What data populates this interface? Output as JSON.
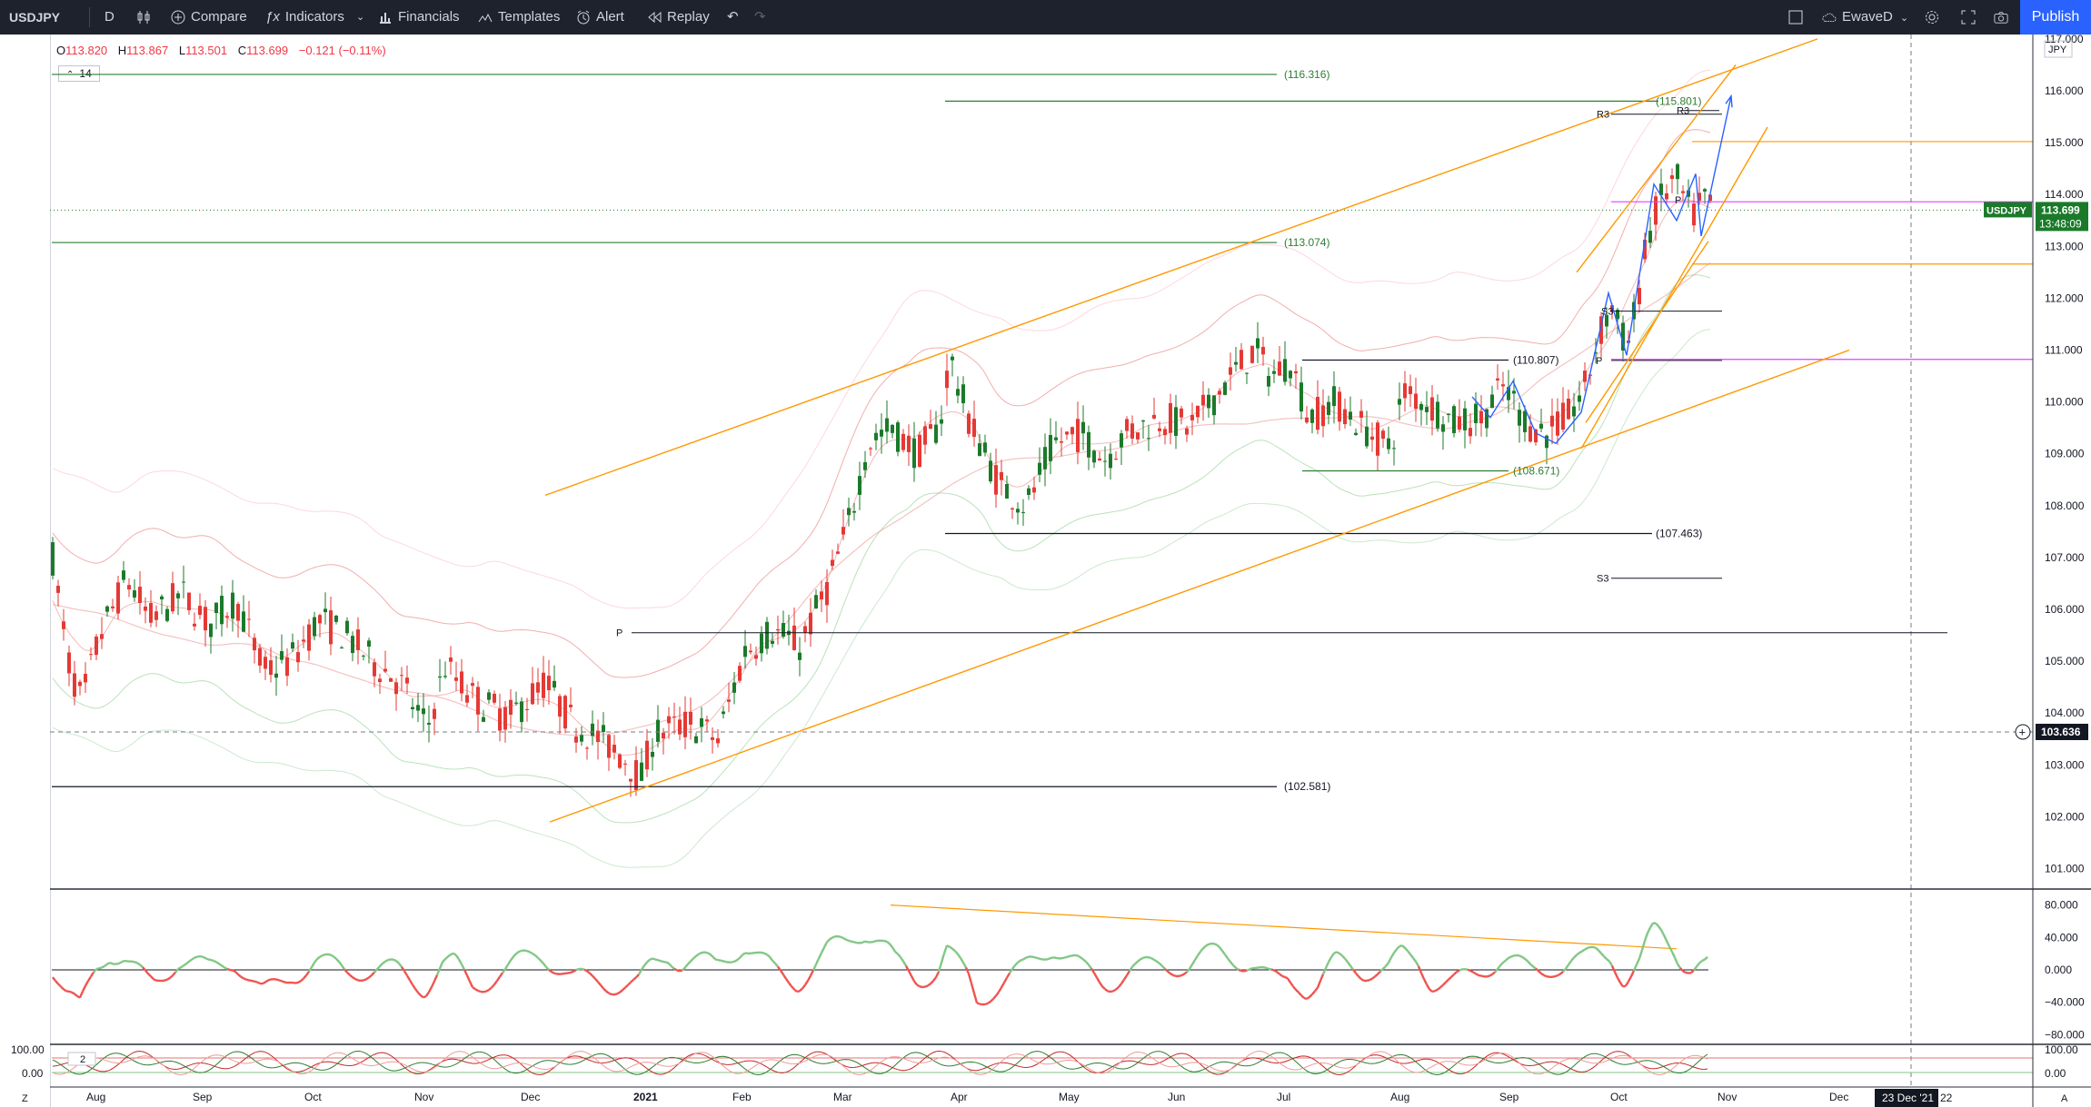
{
  "toolbar": {
    "symbol": "USDJPY",
    "interval": "D",
    "compare_label": "Compare",
    "indicators_label": "Indicators",
    "financials_label": "Financials",
    "templates_label": "Templates",
    "alert_label": "Alert",
    "replay_label": "Replay",
    "layout_name": "EwaveD",
    "publish_label": "Publish"
  },
  "legend": {
    "o_label": "O",
    "o": "113.820",
    "h_label": "H",
    "h": "113.867",
    "l_label": "L",
    "l": "113.501",
    "c_label": "C",
    "c": "113.699",
    "change": "−0.121 (−0.11%)",
    "rsi_period": "14",
    "stoch_period": "2"
  },
  "price_scale": {
    "currency": "JPY",
    "ticks": [
      "117.000",
      "116.000",
      "115.000",
      "114.000",
      "113.000",
      "112.000",
      "111.000",
      "110.000",
      "109.000",
      "108.000",
      "107.000",
      "106.000",
      "105.000",
      "104.000",
      "103.000",
      "102.000",
      "101.000"
    ],
    "last_label": "USDJPY",
    "last_price": "113.699",
    "countdown": "13:48:09",
    "crosshair_price": "103.636"
  },
  "rsi_scale": {
    "ticks": [
      "80.000",
      "40.000",
      "0.000",
      "−40.000",
      "−80.000"
    ]
  },
  "stoch_scale": {
    "ticks": [
      "100.00",
      "0.00"
    ]
  },
  "time_axis": {
    "labels": [
      "Aug",
      "Sep",
      "Oct",
      "Nov",
      "Dec",
      "2021",
      "Feb",
      "Mar",
      "Apr",
      "May",
      "Jun",
      "Jul",
      "Aug",
      "Sep",
      "Oct",
      "Nov",
      "Dec"
    ],
    "crosshair_date": "23 Dec '21",
    "trailing": "22"
  },
  "annotations": {
    "levels": [
      "(116.316)",
      "(115.801)",
      "(113.074)",
      "(110.807)",
      "(108.671)",
      "(107.463)",
      "(102.581)"
    ],
    "pivots": [
      "R3",
      "P",
      "S3",
      "P",
      "R3",
      "S3",
      "P"
    ]
  },
  "bottom_bar": {
    "left_icon": "Z",
    "right_icon": "A"
  },
  "colors": {
    "up": "#26a69a",
    "up_candle": "#1b7a2a",
    "down": "#e53935",
    "fib_green": "#2e7d32",
    "channel": "#ff9800",
    "wave": "#2962ff",
    "magenta": "#e040fb",
    "toolbar_bg": "#1e222d",
    "publish_bg": "#2962ff"
  }
}
